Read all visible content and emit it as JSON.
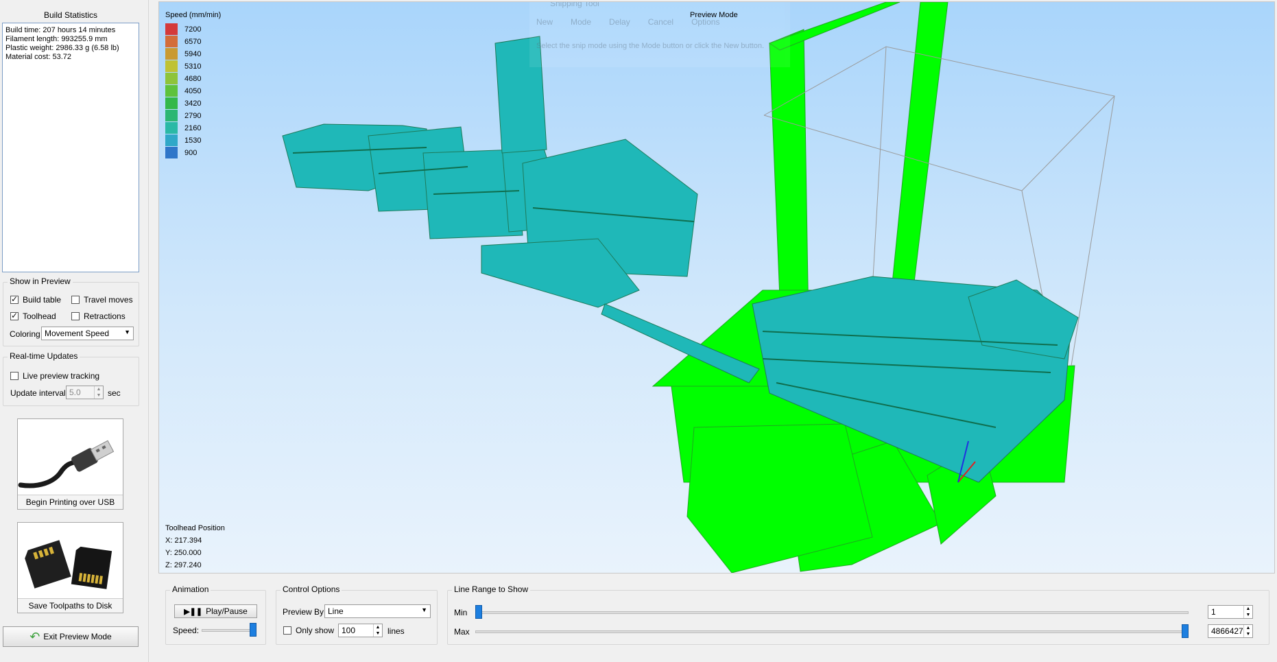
{
  "left": {
    "build_statistics_title": "Build Statistics",
    "stats": {
      "build_time": "Build time: 207 hours 14 minutes",
      "filament_length": "Filament length: 993255.9 mm",
      "plastic_weight": "Plastic weight: 2986.33 g (6.58 lb)",
      "material_cost": "Material cost: 53.72"
    },
    "show_in_preview": {
      "title": "Show in Preview",
      "build_table": {
        "label": "Build table",
        "checked": true
      },
      "travel_moves": {
        "label": "Travel moves",
        "checked": false
      },
      "toolhead": {
        "label": "Toolhead",
        "checked": true
      },
      "retractions": {
        "label": "Retractions",
        "checked": false
      },
      "coloring_label": "Coloring",
      "coloring_value": "Movement Speed"
    },
    "realtime": {
      "title": "Real-time Updates",
      "live_preview": {
        "label": "Live preview tracking",
        "checked": false
      },
      "interval_label": "Update interval",
      "interval_value": "5.0",
      "interval_unit": "sec"
    },
    "usb_button_label": "Begin Printing over USB",
    "disk_button_label": "Save Toolpaths to Disk",
    "exit_button_label": "Exit Preview Mode"
  },
  "viewport": {
    "mode_title": "Preview Mode",
    "legend": {
      "title": "Speed (mm/min)",
      "entries": [
        {
          "value": "7200",
          "color": "#d43a3a"
        },
        {
          "value": "6570",
          "color": "#d36d3a"
        },
        {
          "value": "5940",
          "color": "#c99a33"
        },
        {
          "value": "5310",
          "color": "#bfc235"
        },
        {
          "value": "4680",
          "color": "#8ec43a"
        },
        {
          "value": "4050",
          "color": "#5ec23c"
        },
        {
          "value": "3420",
          "color": "#33b84a"
        },
        {
          "value": "2790",
          "color": "#2cb673"
        },
        {
          "value": "2160",
          "color": "#2ab9a6"
        },
        {
          "value": "1530",
          "color": "#2fa8c8"
        },
        {
          "value": "900",
          "color": "#2f76c9"
        }
      ]
    },
    "toolhead": {
      "title": "Toolhead Position",
      "x": "X: 217.394",
      "y": "Y: 250.000",
      "z": "Z: 297.240"
    },
    "snipping_overlay": {
      "title": "Snipping Tool",
      "new": "New",
      "mode": "Mode",
      "delay": "Delay",
      "cancel": "Cancel",
      "options": "Options",
      "hint": "Select the snip mode using the Mode button or click the New button."
    }
  },
  "bottom": {
    "animation": {
      "title": "Animation",
      "play_label": "Play/Pause",
      "speed_label": "Speed:",
      "speed_level": 1.0
    },
    "control": {
      "title": "Control Options",
      "preview_by_label": "Preview By",
      "preview_by_value": "Line",
      "only_show_label": "Only show",
      "only_show_checked": false,
      "only_show_value": "100",
      "lines_label": "lines"
    },
    "line_range": {
      "title": "Line Range to Show",
      "min_label": "Min",
      "max_label": "Max",
      "min_value": "1",
      "max_value": "4866427"
    }
  },
  "colors": {
    "frame_green": "#00ff00",
    "toolpath_cyan": "#1fb8b8",
    "accent_blue": "#1d7fe0"
  }
}
